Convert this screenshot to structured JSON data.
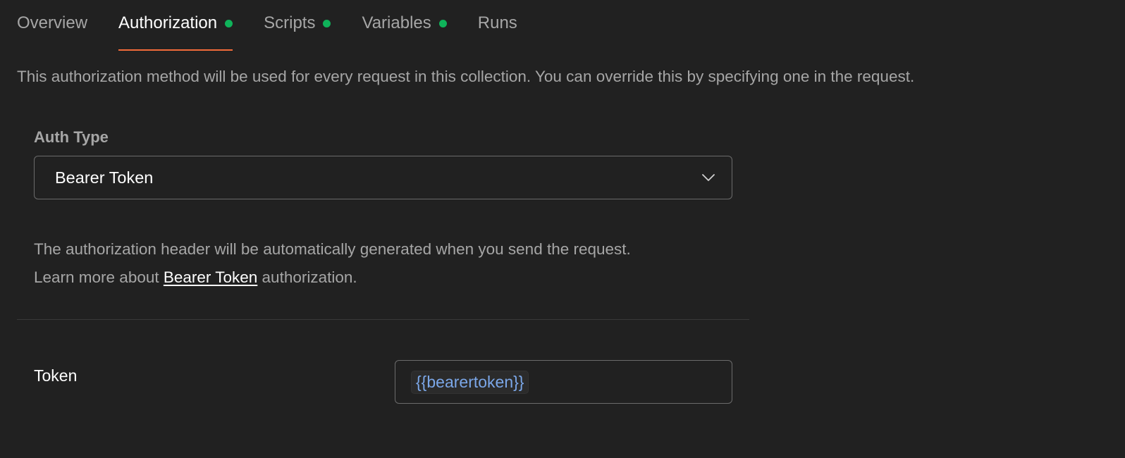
{
  "tabs": [
    {
      "label": "Overview",
      "active": false,
      "has_dot": false
    },
    {
      "label": "Authorization",
      "active": true,
      "has_dot": true
    },
    {
      "label": "Scripts",
      "active": false,
      "has_dot": true
    },
    {
      "label": "Variables",
      "active": false,
      "has_dot": true
    },
    {
      "label": "Runs",
      "active": false,
      "has_dot": false
    }
  ],
  "description": "This authorization method will be used for every request in this collection. You can override this by specifying one in the request.",
  "auth": {
    "label": "Auth Type",
    "selected": "Bearer Token",
    "info_line1": "The authorization header will be automatically generated when you send the request.",
    "info_prefix": "Learn more about ",
    "info_link": "Bearer Token",
    "info_suffix": " authorization."
  },
  "token": {
    "label": "Token",
    "value": "{{bearertoken}}"
  },
  "colors": {
    "background": "#212121",
    "tab_active_underline": "#f26b3a",
    "dot_green": "#0fb35a",
    "variable_blue": "#7ba7e8"
  }
}
